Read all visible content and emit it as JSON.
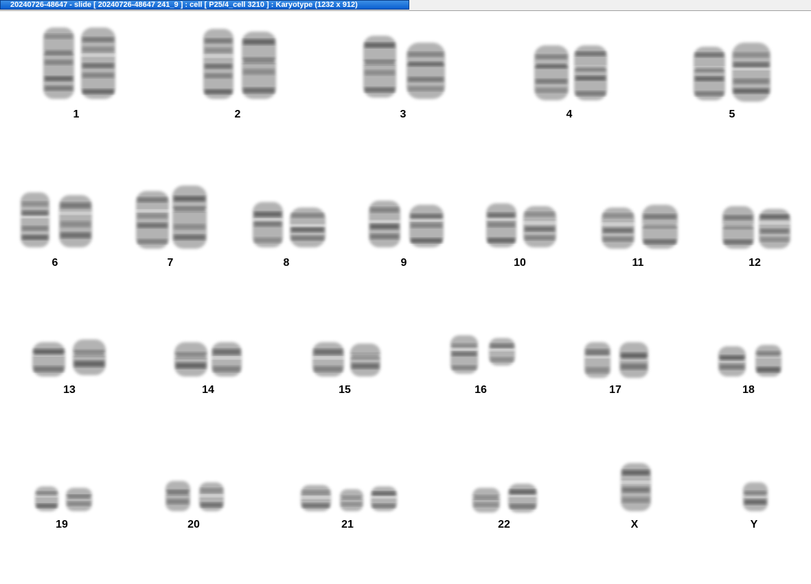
{
  "window": {
    "title": "20240726-48647 - slide [ 20240726-48647 241_9 ] : cell [ P25/4_cell 3210 ] : Karyotype  (1232 x 912)"
  },
  "karyotype": {
    "labels": [
      "1",
      "2",
      "3",
      "4",
      "5",
      "6",
      "7",
      "8",
      "9",
      "10",
      "11",
      "12",
      "13",
      "14",
      "15",
      "16",
      "17",
      "18",
      "19",
      "20",
      "21",
      "22",
      "X",
      "Y"
    ]
  },
  "colors": {
    "tab_active": "#1a6fe0",
    "chromosome": "#606060"
  }
}
